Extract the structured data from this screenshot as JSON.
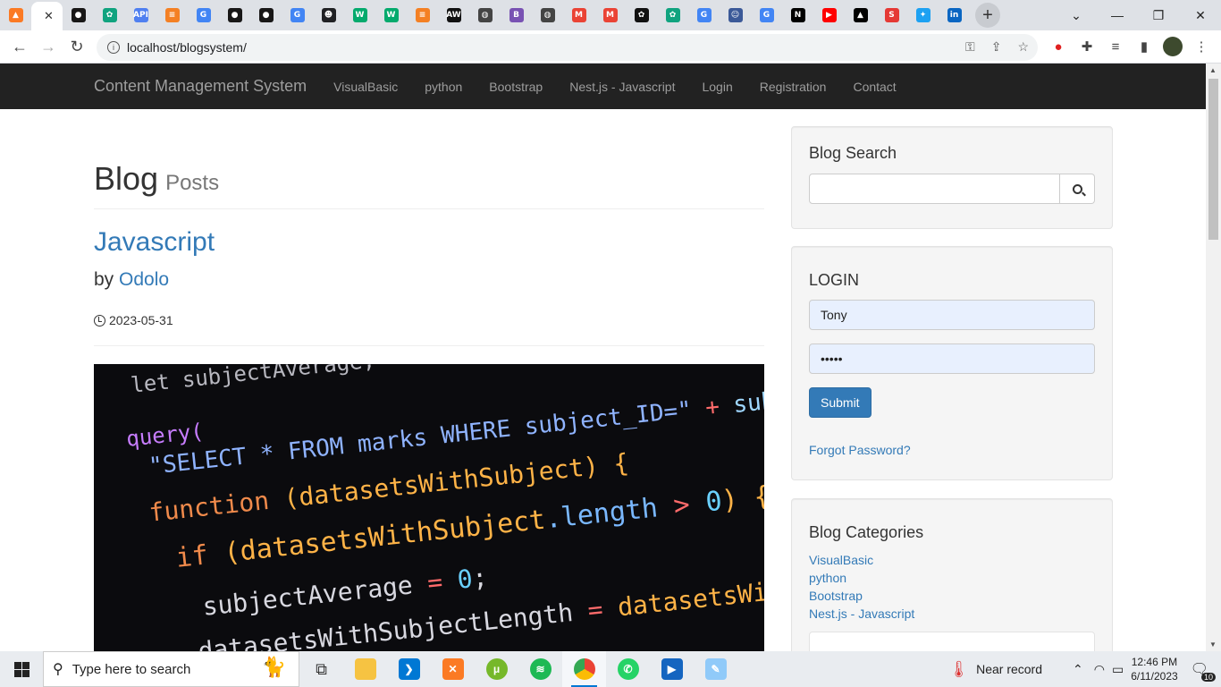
{
  "browser": {
    "tabs": [
      {
        "icon": "xampp-icon",
        "color": "#fb7a24",
        "glyph": "▲"
      },
      {
        "icon": "active-tab-close-icon",
        "color": "#ffffff",
        "glyph": ""
      },
      {
        "icon": "github-icon",
        "color": "#181717",
        "glyph": "●"
      },
      {
        "icon": "chatgpt-icon",
        "color": "#10a37f",
        "glyph": "✿"
      },
      {
        "icon": "api-icon",
        "color": "#4f7ff0",
        "glyph": "API"
      },
      {
        "icon": "stackoverflow-icon",
        "color": "#f48024",
        "glyph": "≡"
      },
      {
        "icon": "google-icon",
        "color": "#4285f4",
        "glyph": "G"
      },
      {
        "icon": "github-icon",
        "color": "#181717",
        "glyph": "●"
      },
      {
        "icon": "github-icon",
        "color": "#181717",
        "glyph": "●"
      },
      {
        "icon": "google-icon",
        "color": "#4285f4",
        "glyph": "G"
      },
      {
        "icon": "contacts-icon",
        "color": "#202124",
        "glyph": "☻"
      },
      {
        "icon": "w3schools-icon",
        "color": "#04aa6d",
        "glyph": "W"
      },
      {
        "icon": "w3schools-icon",
        "color": "#04aa6d",
        "glyph": "W"
      },
      {
        "icon": "stackoverflow-icon",
        "color": "#f48024",
        "glyph": "≡"
      },
      {
        "icon": "aw-icon",
        "color": "#111111",
        "glyph": "AW"
      },
      {
        "icon": "globe-icon",
        "color": "#444444",
        "glyph": "◍"
      },
      {
        "icon": "bootstrap-icon",
        "color": "#7952b3",
        "glyph": "B"
      },
      {
        "icon": "globe-icon",
        "color": "#444444",
        "glyph": "◍"
      },
      {
        "icon": "gmail-icon",
        "color": "#ea4335",
        "glyph": "M"
      },
      {
        "icon": "gmail-icon",
        "color": "#ea4335",
        "glyph": "M"
      },
      {
        "icon": "openai-icon",
        "color": "#111111",
        "glyph": "✿"
      },
      {
        "icon": "chatgpt-icon",
        "color": "#10a37f",
        "glyph": "✿"
      },
      {
        "icon": "google-icon",
        "color": "#4285f4",
        "glyph": "G"
      },
      {
        "icon": "mascot-icon",
        "color": "#3b5998",
        "glyph": "☺"
      },
      {
        "icon": "google-icon",
        "color": "#4285f4",
        "glyph": "G"
      },
      {
        "icon": "nextjs-icon",
        "color": "#000000",
        "glyph": "N"
      },
      {
        "icon": "youtube-icon",
        "color": "#ff0000",
        "glyph": "▶"
      },
      {
        "icon": "vercel-icon",
        "color": "#000000",
        "glyph": "▲"
      },
      {
        "icon": "s-icon",
        "color": "#e53935",
        "glyph": "S"
      },
      {
        "icon": "twitter-icon",
        "color": "#1da1f2",
        "glyph": "✦"
      },
      {
        "icon": "linkedin-icon",
        "color": "#0a66c2",
        "glyph": "in"
      }
    ],
    "url": "localhost/blogsystem/"
  },
  "site": {
    "brand": "Content Management System",
    "nav": [
      "VisualBasic",
      "python",
      "Bootstrap",
      "Nest.js - Javascript",
      "Login",
      "Registration",
      "Contact"
    ]
  },
  "main": {
    "heading": "Blog",
    "heading_small": "Posts",
    "post": {
      "title": "Javascript",
      "by": "by",
      "author": "Odolo",
      "date": "2023-05-31"
    }
  },
  "sidebar": {
    "search_title": "Blog Search",
    "login_title": "LOGIN",
    "username_value": "Tony",
    "password_value": "•••••",
    "submit_label": "Submit",
    "forgot_label": "Forgot Password?",
    "categories_title": "Blog Categories",
    "categories": [
      "VisualBasic",
      "python",
      "Bootstrap",
      "Nest.js - Javascript"
    ]
  },
  "taskbar": {
    "search_placeholder": "Type here to search",
    "weather": "Near record",
    "time": "12:46 PM",
    "date": "6/11/2023",
    "notifications": "10"
  }
}
